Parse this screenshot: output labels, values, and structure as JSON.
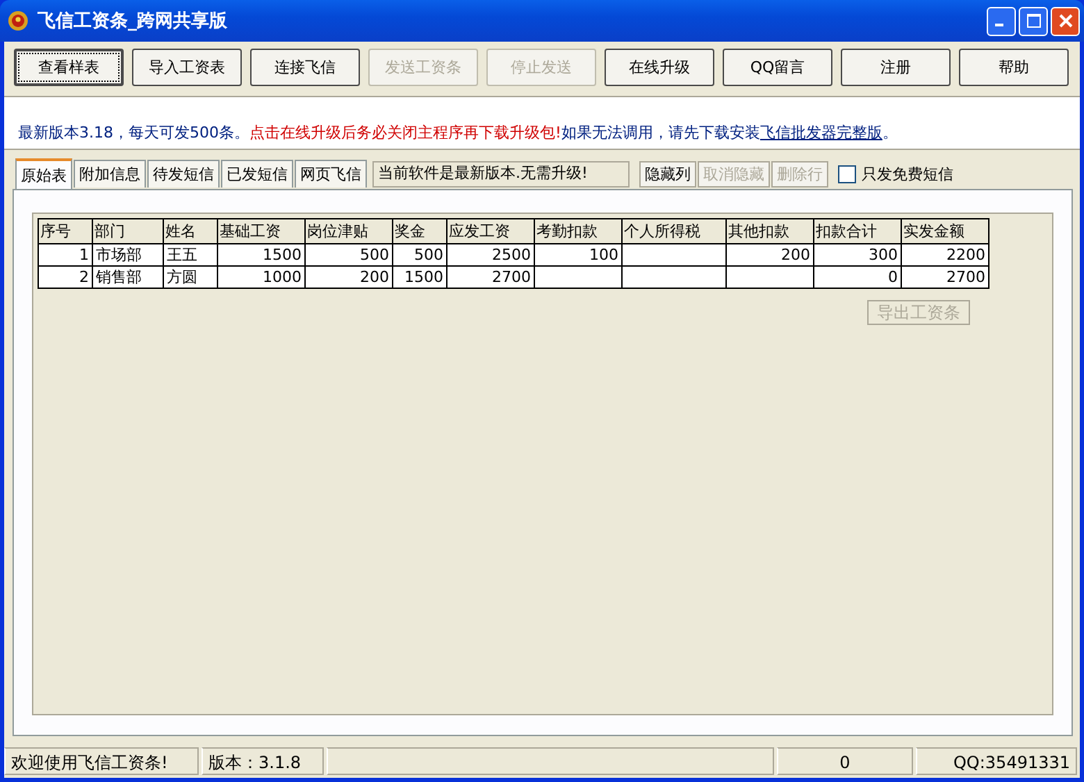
{
  "window": {
    "title": "飞信工资条_跨网共享版"
  },
  "toolbar": [
    {
      "label": "查看样表",
      "disabled": false,
      "focused": true
    },
    {
      "label": "导入工资表",
      "disabled": false,
      "focused": false
    },
    {
      "label": "连接飞信",
      "disabled": false,
      "focused": false
    },
    {
      "label": "发送工资条",
      "disabled": true,
      "focused": false
    },
    {
      "label": "停止发送",
      "disabled": true,
      "focused": false
    },
    {
      "label": "在线升级",
      "disabled": false,
      "focused": false
    },
    {
      "label": "QQ留言",
      "disabled": false,
      "focused": false
    },
    {
      "label": "注册",
      "disabled": false,
      "focused": false
    },
    {
      "label": "帮助",
      "disabled": false,
      "focused": false
    }
  ],
  "notice": [
    {
      "kind": "text",
      "text": "最新版本3.18，每天可发500条。"
    },
    {
      "kind": "alert",
      "text": "点击在线升级后务必关闭主程序再下载升级包!"
    },
    {
      "kind": "text",
      "text": "如果无法调用，请先下载安装"
    },
    {
      "kind": "link",
      "text": "飞信批发器完整版"
    },
    {
      "kind": "text",
      "text": "。"
    }
  ],
  "tabs": [
    {
      "label": "原始表",
      "selected": true
    },
    {
      "label": "附加信息",
      "selected": false
    },
    {
      "label": "待发短信",
      "selected": false
    },
    {
      "label": "已发短信",
      "selected": false
    },
    {
      "label": "网页飞信",
      "selected": false
    }
  ],
  "status_message": "当前软件是最新版本.无需升级!",
  "row_buttons": [
    {
      "label": "隐藏列",
      "disabled": false
    },
    {
      "label": "取消隐藏",
      "disabled": true
    },
    {
      "label": "删除行",
      "disabled": true
    }
  ],
  "free_only": {
    "label": "只发免费短信",
    "checked": false
  },
  "table": {
    "columns": [
      "序号",
      "部门",
      "姓名",
      "基础工资",
      "岗位津贴",
      "奖金",
      "应发工资",
      "考勤扣款",
      "个人所得税",
      "其他扣款",
      "扣款合计",
      "实发金额"
    ],
    "rows": [
      [
        "1",
        "市场部",
        "王五",
        "1500",
        "500",
        "500",
        "2500",
        "100",
        "",
        "200",
        "300",
        "2200"
      ],
      [
        "2",
        "销售部",
        "方圆",
        "1000",
        "200",
        "1500",
        "2700",
        "",
        "",
        "",
        "0",
        "2700"
      ]
    ]
  },
  "export_button": {
    "label": "导出工资条",
    "disabled": true
  },
  "status_bar": [
    "欢迎使用飞信工资条!",
    "版本：3.1.8",
    "0",
    "QQ:35491331"
  ]
}
